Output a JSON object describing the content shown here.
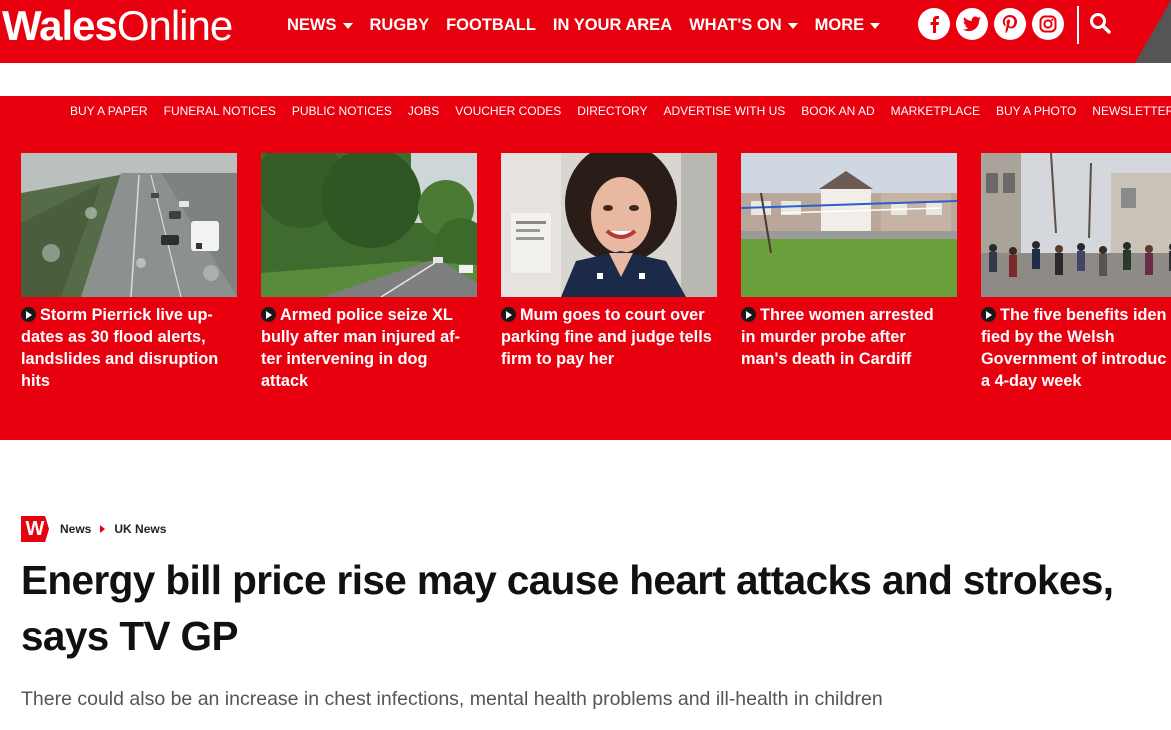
{
  "brand": {
    "name_bold": "Wales",
    "name_light": "Online",
    "accent": "#e8000e"
  },
  "main_nav": [
    {
      "label": "NEWS",
      "has_dropdown": true
    },
    {
      "label": "RUGBY",
      "has_dropdown": false
    },
    {
      "label": "FOOTBALL",
      "has_dropdown": false
    },
    {
      "label": "IN YOUR AREA",
      "has_dropdown": false
    },
    {
      "label": "WHAT'S ON",
      "has_dropdown": true
    },
    {
      "label": "MORE",
      "has_dropdown": true
    }
  ],
  "social_icons": [
    "facebook-icon",
    "twitter-icon",
    "pinterest-icon",
    "instagram-icon"
  ],
  "search_icon": "search-icon",
  "secondary_nav": [
    "BUY A PAPER",
    "FUNERAL NOTICES",
    "PUBLIC NOTICES",
    "JOBS",
    "VOUCHER CODES",
    "DIRECTORY",
    "ADVERTISE WITH US",
    "BOOK AN AD",
    "MARKETPLACE",
    "BUY A PHOTO",
    "NEWSLETTER SIGNUP"
  ],
  "teasers": [
    {
      "lines": [
        "Storm Pierrick live up-",
        "dates as 30 flood alerts,",
        "landslides and disruption",
        "hits"
      ]
    },
    {
      "lines": [
        "Armed police seize XL",
        "bully after man injured af-",
        "ter intervening in dog",
        "attack"
      ]
    },
    {
      "lines": [
        "Mum goes to court over",
        "parking fine and judge tells",
        "firm to pay her"
      ]
    },
    {
      "lines": [
        "Three women arrested",
        "in murder probe after",
        "man's death in Cardiff"
      ]
    },
    {
      "lines": [
        "The five benefits iden",
        "fied by the Welsh",
        "Government of introduc",
        "a 4-day week"
      ]
    }
  ],
  "breadcrumb": {
    "badge": "W",
    "items": [
      "News",
      "UK News"
    ]
  },
  "article": {
    "title_lines": [
      "Energy bill price rise may cause heart attacks and strokes,",
      "says TV GP"
    ],
    "standfirst": "There could also be an increase in chest infections, mental health problems and ill-health in children"
  }
}
